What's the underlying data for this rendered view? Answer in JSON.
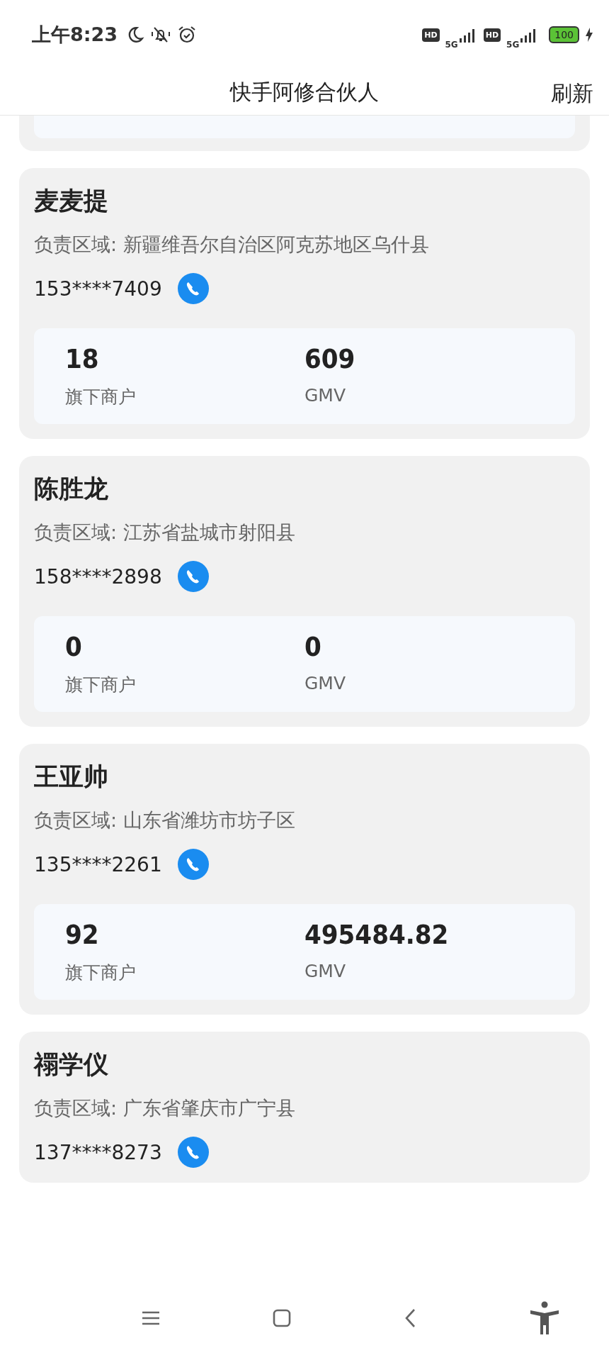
{
  "status_bar": {
    "time": "上午8:23",
    "sim1": {
      "hd": "HD",
      "network": "5G"
    },
    "sim2": {
      "hd": "HD",
      "network": "5G"
    },
    "battery": "100"
  },
  "header": {
    "title": "快手阿修合伙人",
    "action": "刷新"
  },
  "partners": [
    {
      "name": "麦麦提",
      "region": "负责区域: 新疆维吾尔自治区阿克苏地区乌什县",
      "phone": "153****7409",
      "stats": [
        {
          "value": "18",
          "label": "旗下商户"
        },
        {
          "value": "609",
          "label": "GMV"
        }
      ]
    },
    {
      "name": "陈胜龙",
      "region": "负责区域: 江苏省盐城市射阳县",
      "phone": "158****2898",
      "stats": [
        {
          "value": "0",
          "label": "旗下商户"
        },
        {
          "value": "0",
          "label": "GMV"
        }
      ]
    },
    {
      "name": "王亚帅",
      "region": "负责区域: 山东省潍坊市坊子区",
      "phone": "135****2261",
      "stats": [
        {
          "value": "92",
          "label": "旗下商户"
        },
        {
          "value": "495484.82",
          "label": "GMV"
        }
      ]
    },
    {
      "name": "禤学仪",
      "region": "负责区域: 广东省肇庆市广宁县",
      "phone": "137****8273"
    }
  ]
}
